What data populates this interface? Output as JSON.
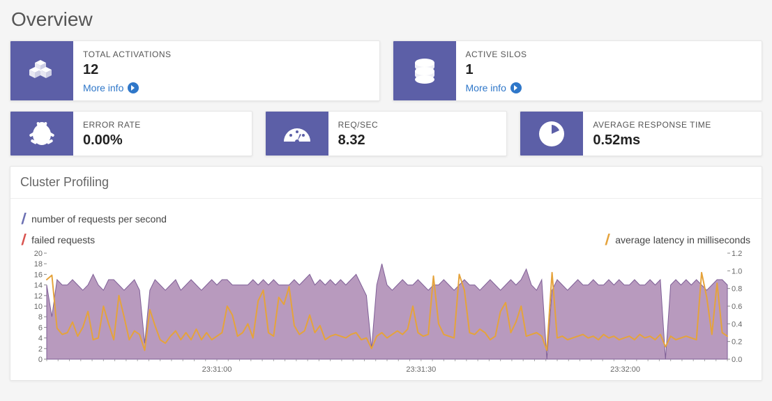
{
  "page_title": "Overview",
  "cards_top": [
    {
      "label": "TOTAL ACTIVATIONS",
      "value": "12",
      "more": "More info",
      "icon": "activations-icon"
    },
    {
      "label": "ACTIVE SILOS",
      "value": "1",
      "more": "More info",
      "icon": "silos-icon"
    }
  ],
  "cards_bottom": [
    {
      "label": "ERROR RATE",
      "value": "0.00%",
      "icon": "error-icon"
    },
    {
      "label": "REQ/SEC",
      "value": "8.32",
      "icon": "gauge-icon"
    },
    {
      "label": "AVERAGE RESPONSE TIME",
      "value": "0.52ms",
      "icon": "clock-icon"
    }
  ],
  "cluster_panel": {
    "title": "Cluster Profiling",
    "legend": {
      "requests": "number of requests per second",
      "failed": "failed requests",
      "latency": "average latency in milliseconds"
    }
  },
  "colors": {
    "accent": "#5c5fa7",
    "area": "#a078a8",
    "area_stroke": "#7e5e96",
    "latency": "#e5a33c",
    "failed": "#d9534f",
    "requests_mark": "#6b6fb2"
  },
  "chart_data": {
    "type": "area",
    "x_ticks": [
      "23:31:00",
      "23:31:30",
      "23:32:00"
    ],
    "left_axis": {
      "label": "",
      "min": 0,
      "max": 20,
      "ticks": [
        0,
        2,
        4,
        6,
        8,
        10,
        12,
        14,
        16,
        18,
        20
      ]
    },
    "right_axis": {
      "label": "",
      "min": 0,
      "max": 1.2,
      "ticks": [
        0,
        0.2,
        0.4,
        0.6,
        0.8,
        1.0,
        1.2
      ]
    },
    "series": [
      {
        "name": "requests_per_second",
        "axis": "left",
        "values": [
          14,
          8,
          15,
          14,
          14,
          15,
          14,
          13,
          14,
          16,
          14,
          13,
          15,
          15,
          14,
          13,
          14,
          15,
          13,
          3,
          13,
          15,
          14,
          13,
          14,
          15,
          13,
          14,
          15,
          14,
          13,
          14,
          15,
          14,
          15,
          15,
          14,
          14,
          14,
          14,
          15,
          14,
          15,
          14,
          15,
          14,
          14,
          14,
          15,
          14,
          15,
          16,
          14,
          15,
          14,
          15,
          14,
          15,
          14,
          15,
          16,
          14,
          12,
          2,
          14,
          18,
          14,
          13,
          14,
          15,
          14,
          14,
          15,
          14,
          13,
          14,
          14,
          15,
          14,
          13,
          14,
          15,
          14,
          14,
          13,
          14,
          15,
          14,
          13,
          14,
          15,
          14,
          15,
          17,
          14,
          13,
          15,
          0,
          13,
          15,
          14,
          13,
          14,
          15,
          14,
          14,
          15,
          14,
          14,
          15,
          14,
          15,
          14,
          14,
          15,
          14,
          14,
          15,
          14,
          15,
          0,
          14,
          15,
          14,
          15,
          14,
          15,
          14,
          13,
          14,
          15,
          15,
          14
        ]
      },
      {
        "name": "average_latency_ms",
        "axis": "right",
        "values": [
          0.9,
          0.95,
          0.35,
          0.28,
          0.3,
          0.42,
          0.26,
          0.36,
          0.54,
          0.22,
          0.24,
          0.6,
          0.4,
          0.22,
          0.72,
          0.48,
          0.22,
          0.32,
          0.28,
          0.1,
          0.56,
          0.38,
          0.22,
          0.18,
          0.26,
          0.32,
          0.22,
          0.3,
          0.22,
          0.34,
          0.22,
          0.3,
          0.22,
          0.26,
          0.3,
          0.6,
          0.5,
          0.26,
          0.3,
          0.4,
          0.24,
          0.66,
          0.78,
          0.3,
          0.26,
          0.7,
          0.62,
          0.82,
          0.38,
          0.28,
          0.32,
          0.5,
          0.3,
          0.38,
          0.22,
          0.26,
          0.28,
          0.26,
          0.24,
          0.28,
          0.3,
          0.22,
          0.24,
          0.12,
          0.26,
          0.3,
          0.24,
          0.28,
          0.32,
          0.28,
          0.34,
          0.6,
          0.3,
          0.26,
          0.28,
          0.94,
          0.4,
          0.28,
          0.26,
          0.24,
          0.96,
          0.78,
          0.3,
          0.28,
          0.34,
          0.3,
          0.22,
          0.26,
          0.54,
          0.64,
          0.3,
          0.42,
          0.6,
          0.26,
          0.28,
          0.3,
          0.26,
          0.1,
          0.98,
          0.24,
          0.26,
          0.22,
          0.24,
          0.26,
          0.28,
          0.24,
          0.26,
          0.22,
          0.28,
          0.24,
          0.26,
          0.22,
          0.24,
          0.26,
          0.22,
          0.28,
          0.24,
          0.26,
          0.22,
          0.28,
          0.14,
          0.26,
          0.22,
          0.24,
          0.26,
          0.24,
          0.22,
          0.98,
          0.7,
          0.28,
          0.86,
          0.3,
          0.26
        ]
      },
      {
        "name": "failed_requests",
        "axis": "left",
        "values_all_zero": true
      }
    ]
  }
}
